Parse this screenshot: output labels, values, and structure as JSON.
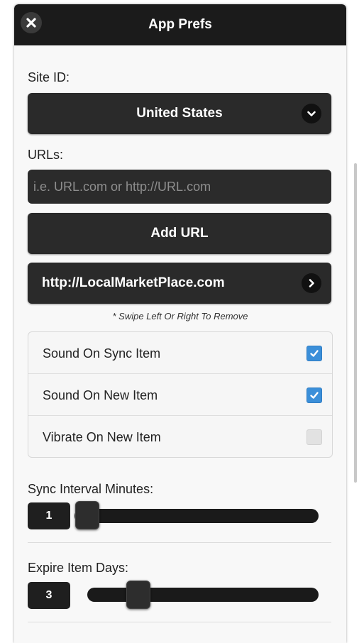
{
  "header": {
    "title": "App Prefs",
    "close_icon": "close-icon"
  },
  "site": {
    "label": "Site ID:",
    "selected": "United States",
    "chevron_icon": "chevron-down-icon"
  },
  "urls": {
    "label": "URLs:",
    "placeholder": "i.e. URL.com or http://URL.com",
    "add_label": "Add URL",
    "items": [
      {
        "url": "http://LocalMarketPlace.com",
        "icon": "chevron-right-icon"
      }
    ],
    "hint": "* Swipe Left Or Right To Remove"
  },
  "options": [
    {
      "label": "Sound On Sync Item",
      "checked": true
    },
    {
      "label": "Sound On New Item",
      "checked": true
    },
    {
      "label": "Vibrate On New Item",
      "checked": false
    }
  ],
  "sync_interval": {
    "label": "Sync Interval Minutes:",
    "value": "1"
  },
  "expire_days": {
    "label": "Expire Item Days:",
    "value": "3"
  },
  "colors": {
    "header": "#1b1b1b",
    "button": "#2a2a2a",
    "checkbox_on": "#3b8fd9"
  }
}
